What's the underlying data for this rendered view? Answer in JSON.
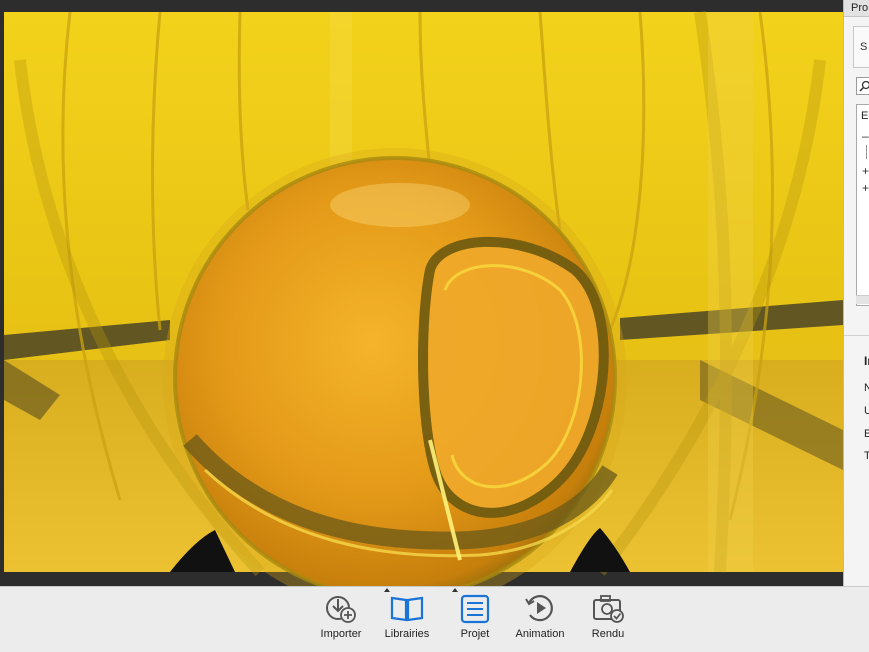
{
  "window": {
    "panel_title": "Pro"
  },
  "side_panel": {
    "tab_label": "S",
    "tree_header": "El",
    "info_title": "In",
    "info_rows": [
      "N",
      "U",
      "E",
      "T"
    ]
  },
  "toolbar": {
    "buttons": [
      {
        "label": "Importer"
      },
      {
        "label": "Librairies"
      },
      {
        "label": "Projet"
      },
      {
        "label": "Animation"
      },
      {
        "label": "Rendu"
      }
    ]
  },
  "colors": {
    "accent": "#1a73d6",
    "scene_gold": "#e0b410",
    "viewport_bg": "#2d2d2d"
  },
  "icons": [
    "import-icon",
    "book-icon",
    "project-list-icon",
    "play-circle-icon",
    "camera-check-icon",
    "search-icon"
  ]
}
